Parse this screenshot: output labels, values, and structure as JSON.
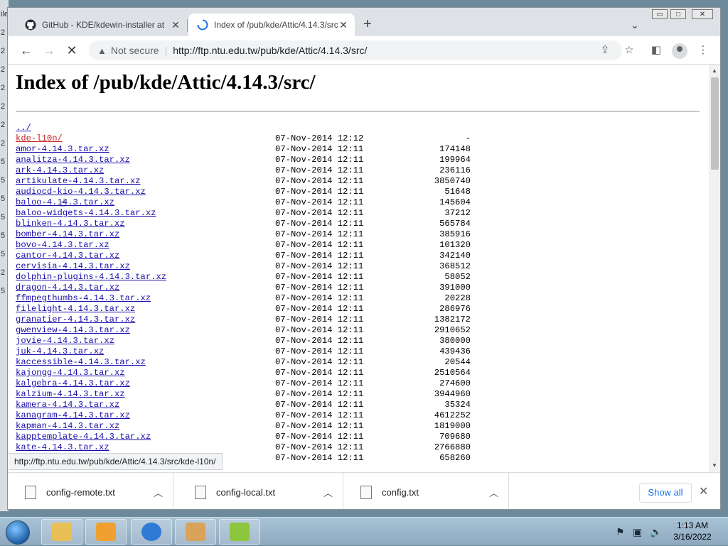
{
  "desktop": {
    "edge_chars": [
      "ile",
      "2",
      "2",
      "2",
      "2",
      "2",
      "2",
      "2",
      "5",
      "5",
      "5",
      "5",
      "5",
      "5",
      "2",
      "5"
    ]
  },
  "tabs": [
    {
      "title": "GitHub - KDE/kdewin-installer at",
      "close": "✕",
      "state": "inactive"
    },
    {
      "title": "Index of /pub/kde/Attic/4.14.3/src",
      "close": "✕",
      "state": "active"
    }
  ],
  "tabbar": {
    "new_tab": "+",
    "tab_menu": "⌄"
  },
  "window_controls": {
    "minimize": "▭",
    "maximize": "□",
    "close": "✕"
  },
  "toolbar": {
    "back": "←",
    "forward": "→",
    "reload": "✕",
    "security_icon": "▲",
    "security_text": "Not secure",
    "url": "http://ftp.ntu.edu.tw/pub/kde/Attic/4.14.3/src/"
  },
  "page": {
    "heading": "Index of /pub/kde/Attic/4.14.3/src/",
    "rows": [
      {
        "name": "../",
        "date": "",
        "size": ""
      },
      {
        "name": "kde-l10n/",
        "date": "07-Nov-2014 12:12",
        "size": "-",
        "visited": true
      },
      {
        "name": "amor-4.14.3.tar.xz",
        "date": "07-Nov-2014 12:11",
        "size": "174148"
      },
      {
        "name": "analitza-4.14.3.tar.xz",
        "date": "07-Nov-2014 12:11",
        "size": "199964"
      },
      {
        "name": "ark-4.14.3.tar.xz",
        "date": "07-Nov-2014 12:11",
        "size": "236116"
      },
      {
        "name": "artikulate-4.14.3.tar.xz",
        "date": "07-Nov-2014 12:11",
        "size": "3850740"
      },
      {
        "name": "audiocd-kio-4.14.3.tar.xz",
        "date": "07-Nov-2014 12:11",
        "size": "51648"
      },
      {
        "name": "baloo-4.14.3.tar.xz",
        "date": "07-Nov-2014 12:11",
        "size": "145604"
      },
      {
        "name": "baloo-widgets-4.14.3.tar.xz",
        "date": "07-Nov-2014 12:11",
        "size": "37212"
      },
      {
        "name": "blinken-4.14.3.tar.xz",
        "date": "07-Nov-2014 12:11",
        "size": "565784"
      },
      {
        "name": "bomber-4.14.3.tar.xz",
        "date": "07-Nov-2014 12:11",
        "size": "385916"
      },
      {
        "name": "bovo-4.14.3.tar.xz",
        "date": "07-Nov-2014 12:11",
        "size": "101320"
      },
      {
        "name": "cantor-4.14.3.tar.xz",
        "date": "07-Nov-2014 12:11",
        "size": "342140"
      },
      {
        "name": "cervisia-4.14.3.tar.xz",
        "date": "07-Nov-2014 12:11",
        "size": "368512"
      },
      {
        "name": "dolphin-plugins-4.14.3.tar.xz",
        "date": "07-Nov-2014 12:11",
        "size": "58052"
      },
      {
        "name": "dragon-4.14.3.tar.xz",
        "date": "07-Nov-2014 12:11",
        "size": "391000"
      },
      {
        "name": "ffmpegthumbs-4.14.3.tar.xz",
        "date": "07-Nov-2014 12:11",
        "size": "20228"
      },
      {
        "name": "filelight-4.14.3.tar.xz",
        "date": "07-Nov-2014 12:11",
        "size": "286976"
      },
      {
        "name": "granatier-4.14.3.tar.xz",
        "date": "07-Nov-2014 12:11",
        "size": "1382172"
      },
      {
        "name": "gwenview-4.14.3.tar.xz",
        "date": "07-Nov-2014 12:11",
        "size": "2910652"
      },
      {
        "name": "jovie-4.14.3.tar.xz",
        "date": "07-Nov-2014 12:11",
        "size": "380000"
      },
      {
        "name": "juk-4.14.3.tar.xz",
        "date": "07-Nov-2014 12:11",
        "size": "439436"
      },
      {
        "name": "kaccessible-4.14.3.tar.xz",
        "date": "07-Nov-2014 12:11",
        "size": "20544"
      },
      {
        "name": "kajongg-4.14.3.tar.xz",
        "date": "07-Nov-2014 12:11",
        "size": "2510564"
      },
      {
        "name": "kalgebra-4.14.3.tar.xz",
        "date": "07-Nov-2014 12:11",
        "size": "274600"
      },
      {
        "name": "kalzium-4.14.3.tar.xz",
        "date": "07-Nov-2014 12:11",
        "size": "3944960"
      },
      {
        "name": "kamera-4.14.3.tar.xz",
        "date": "07-Nov-2014 12:11",
        "size": "35324"
      },
      {
        "name": "kanagram-4.14.3.tar.xz",
        "date": "07-Nov-2014 12:11",
        "size": "4612252"
      },
      {
        "name": "kapman-4.14.3.tar.xz",
        "date": "07-Nov-2014 12:11",
        "size": "1819000"
      },
      {
        "name": "kapptemplate-4.14.3.tar.xz",
        "date": "07-Nov-2014 12:11",
        "size": "709680"
      },
      {
        "name": "kate-4.14.3.tar.xz",
        "date": "07-Nov-2014 12:11",
        "size": "2766880"
      },
      {
        "name": "",
        "date": "07-Nov-2014 12:11",
        "size": "658260"
      }
    ]
  },
  "status_url": "http://ftp.ntu.edu.tw/pub/kde/Attic/4.14.3/src/kde-l10n/",
  "downloads": [
    {
      "name": "config-remote.txt"
    },
    {
      "name": "config-local.txt"
    },
    {
      "name": "config.txt"
    }
  ],
  "shelf": {
    "show_all": "Show all",
    "close": "✕"
  },
  "taskbar": {
    "clock_time": "1:13 AM",
    "clock_date": "3/16/2022",
    "colors": {
      "explorer": "#e8c056",
      "media": "#f0a030",
      "chrome": "#2e7bd6",
      "paint": "#d9a35a",
      "notepad": "#8cc63f"
    }
  }
}
